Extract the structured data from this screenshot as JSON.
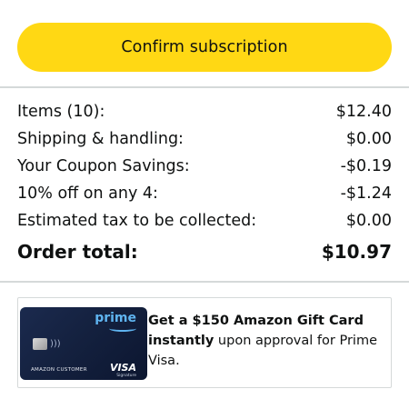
{
  "colors": {
    "button_bg": "#ffd814",
    "divider": "#d5d9d9",
    "text": "#0f1111",
    "card_accent": "#5fb4f0"
  },
  "confirm_button": {
    "label": "Confirm subscription"
  },
  "summary": {
    "rows": [
      {
        "label": "Items (10):",
        "value": "$12.40"
      },
      {
        "label": "Shipping & handling:",
        "value": "$0.00"
      },
      {
        "label": "Your Coupon Savings:",
        "value": "-$0.19"
      },
      {
        "label": "10% off on any 4:",
        "value": "-$1.24"
      },
      {
        "label": "Estimated tax to be collected:",
        "value": "$0.00"
      }
    ],
    "total": {
      "label": "Order total:",
      "value": "$10.97"
    }
  },
  "promo": {
    "card": {
      "brand": "prime",
      "holder": "AMAZON CUSTOMER",
      "network": "VISA",
      "network_sub": "Signature",
      "icon": "credit-card-icon"
    },
    "bold_1": "Get a $150 Amazon Gift Card",
    "bold_2": "instantly",
    "rest": " upon approval for Prime Visa."
  }
}
